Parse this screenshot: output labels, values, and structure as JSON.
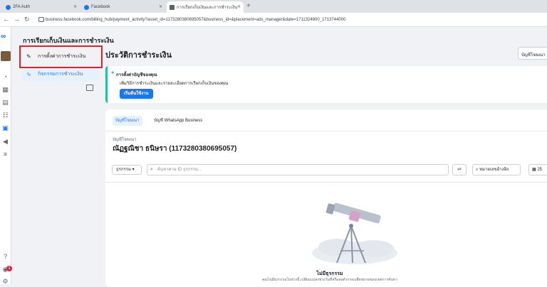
{
  "browser": {
    "tabs": [
      {
        "label": "2FA Auth"
      },
      {
        "label": "Facebook"
      },
      {
        "label": "การเรียกเก็บเงินและการชำระเงิน"
      }
    ],
    "url": "business.facebook.com/billing_hub/payment_activity?asset_id=1173280380695057&business_id=&placement=ads_manager&date=1711324800_1713744000"
  },
  "rail": {
    "logo": "∞",
    "badge_count": "1"
  },
  "page": {
    "title": "การเรียกเก็บเงินและการชำระเงิน"
  },
  "sidebar": {
    "items": [
      {
        "label": "การตั้งค่าการชำระเงิน",
        "icon": "pencil-icon"
      },
      {
        "label": "กิจกรรมการชำระเงิน",
        "icon": "activity-icon"
      }
    ]
  },
  "main": {
    "title": "ประวัติการชำระเงิน",
    "account_selector": "บัญชีโฆษณา"
  },
  "setup": {
    "title": "การตั้งค่าบัญชีของคุณ",
    "description": "เพิ่มวิธีการชำระเงินและรายละเอียดการเรียกเก็บเงินของคุณ",
    "button": "เริ่มต้นใช้งาน"
  },
  "content": {
    "tabs": [
      {
        "label": "บัญชีโฆษณา"
      },
      {
        "label": "บัญชี WhatsApp Business"
      }
    ],
    "account_label": "บัญชีโฆษณา",
    "account_name": "ณัฏฐณิชา ธนิษรา (1173280380695057)",
    "filter_dropdown": "ธุรกรรม",
    "search_placeholder": "ค้นหาตาม ID ธุรกรรม...",
    "note_button": "หมายเลขอ้างอิง",
    "date_button": "25",
    "empty_title": "ไม่มีธุรกรรม",
    "empty_subtitle": "คุณไม่มีธุรกรรมในช่วงนี้ เปลี่ยนแปลงช่วงวันที่หรือลบตัวกรองเพื่อขยายขอบเขตการค้นหา"
  }
}
